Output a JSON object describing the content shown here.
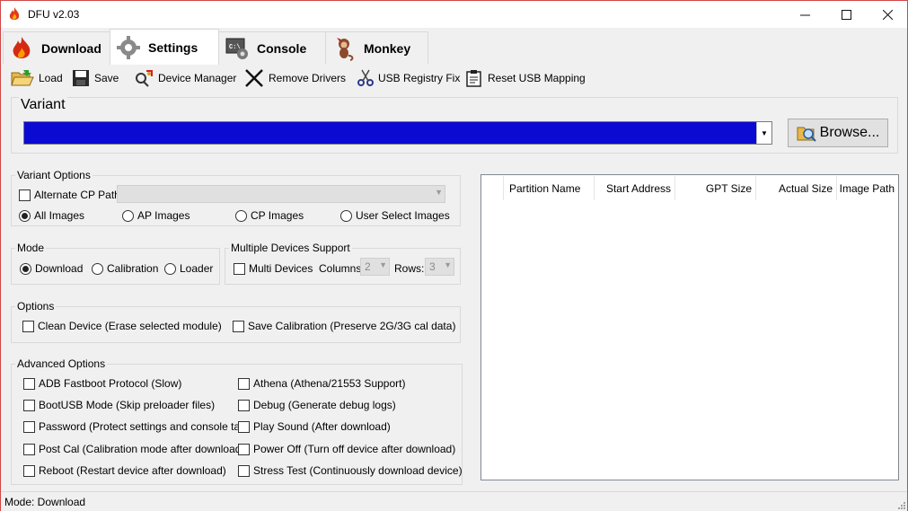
{
  "window": {
    "title": "DFU v2.03",
    "minimize": "—",
    "maximize": "☐",
    "close": "✕"
  },
  "tabs": [
    {
      "label": "Download",
      "icon": "flame-icon"
    },
    {
      "label": "Settings",
      "icon": "gear-icon",
      "active": true
    },
    {
      "label": "Console",
      "icon": "console-icon"
    },
    {
      "label": "Monkey",
      "icon": "monkey-icon"
    }
  ],
  "toolbar": {
    "load": "Load",
    "save": "Save",
    "device_manager": "Device Manager",
    "remove_drivers": "Remove Drivers",
    "registry_fix": "USB Registry Fix",
    "reset_usb": "Reset USB Mapping"
  },
  "variant": {
    "label": "Variant",
    "browse": "Browse..."
  },
  "variant_options": {
    "label": "Variant Options",
    "alt_cp": "Alternate CP Path",
    "radios": [
      "All Images",
      "AP Images",
      "CP Images",
      "User Select Images"
    ]
  },
  "mode": {
    "label": "Mode",
    "radios": [
      "Download",
      "Calibration",
      "Loader"
    ]
  },
  "multi": {
    "label": "Multiple Devices Support",
    "multi_devices": "Multi Devices",
    "columns_label": "Columns:",
    "columns_value": "2",
    "rows_label": "Rows:",
    "rows_value": "3"
  },
  "options": {
    "label": "Options",
    "clean": "Clean Device (Erase selected module)",
    "save_cal": "Save Calibration (Preserve 2G/3G cal data)"
  },
  "advanced": {
    "label": "Advanced Options",
    "left": [
      "ADB Fastboot Protocol (Slow)",
      "BootUSB Mode (Skip preloader files)",
      "Password (Protect settings and console tab)",
      "Post Cal (Calibration mode after download)",
      "Reboot (Restart device after download)"
    ],
    "right": [
      "Athena (Athena/21553 Support)",
      "Debug (Generate debug logs)",
      "Play Sound (After download)",
      "Power Off (Turn off device after download)",
      "Stress Test (Continuously download device)"
    ]
  },
  "table": {
    "columns": [
      "Partition Name",
      "Start Address",
      "GPT Size",
      "Actual Size",
      "Image Path"
    ]
  },
  "status": {
    "text": "Mode: Download"
  },
  "colors": {
    "variant_fill": "#0a0ad2",
    "border_accent": "#d04848"
  }
}
